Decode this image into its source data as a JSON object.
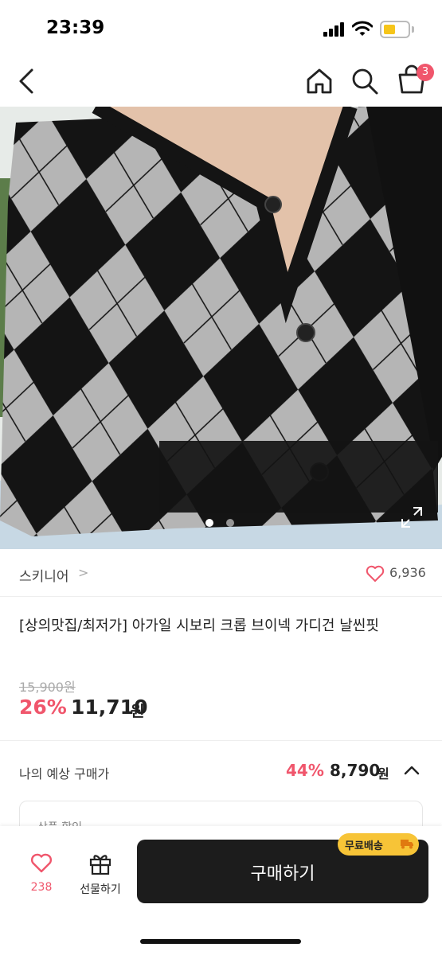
{
  "status_bar": {
    "time": "23:39"
  },
  "header": {
    "cart_count": "3",
    "icons": [
      "back-icon",
      "home-icon",
      "search-icon",
      "cart-icon"
    ]
  },
  "product_image": {
    "slide_count": 2,
    "active_slide": 1,
    "colors": {
      "argyle_dark": "#141414",
      "argyle_light": "#b5b5b5",
      "background": "#e7ebe8"
    }
  },
  "brand": {
    "name": "스키니어",
    "chevron": ">",
    "likes": "6,936"
  },
  "product": {
    "title": "[상의맛집/최저가] 아가일 시보리 크롭 브이넥 가디건 날씬핏",
    "original_price": "15,900원",
    "discount_rate": "26%",
    "sale_price": "11,710",
    "currency": "원"
  },
  "expected": {
    "label": "나의 예상 구매가",
    "discount_rate": "44%",
    "price": "8,790",
    "currency": "원"
  },
  "detail_box": {
    "label": "상품 할인"
  },
  "bottom_bar": {
    "wish_count": "238",
    "gift_label": "선물하기",
    "buy_label": "구매하기",
    "free_shipping_label": "무료배송"
  },
  "colors": {
    "accent": "#f0566c",
    "buy_button": "#1c1c1c",
    "free_shipping": "#f7c437"
  }
}
